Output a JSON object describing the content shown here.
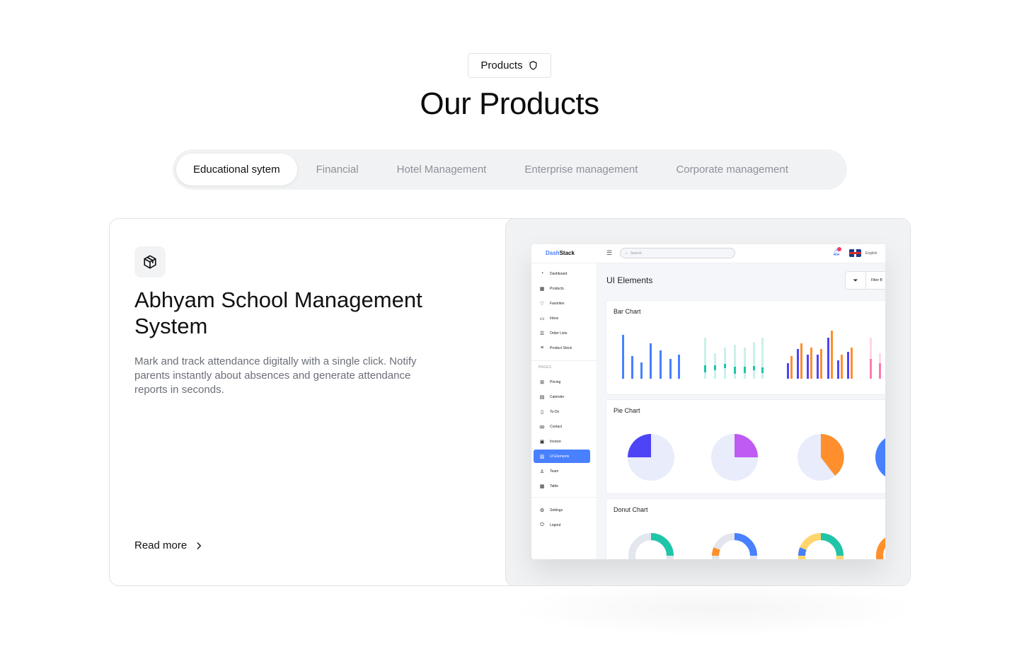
{
  "badge": {
    "label": "Products",
    "icon": "shield-icon"
  },
  "title": "Our Products",
  "tabs": [
    {
      "label": "Educational sytem",
      "active": true
    },
    {
      "label": "Financial",
      "active": false
    },
    {
      "label": "Hotel Management",
      "active": false
    },
    {
      "label": "Enterprise management",
      "active": false
    },
    {
      "label": "Corporate management",
      "active": false
    }
  ],
  "product": {
    "icon": "cube-icon",
    "title": "Abhyam School Management System",
    "description": "Mark and track attendance digitally with a single click. Notify parents instantly about absences and generate attendance reports in seconds.",
    "read_more": "Read more"
  },
  "dashboard": {
    "logo_a": "Dash",
    "logo_b": "Stack",
    "search_placeholder": "Search",
    "language": "English",
    "page_title": "UI Elements",
    "filter_label": "Filter B",
    "sidebar_top": [
      {
        "label": "Dashboard",
        "icon": "dashboard-icon"
      },
      {
        "label": "Products",
        "icon": "grid-icon"
      },
      {
        "label": "Favorites",
        "icon": "heart-icon"
      },
      {
        "label": "Inbox",
        "icon": "inbox-icon"
      },
      {
        "label": "Order Lists",
        "icon": "list-icon"
      },
      {
        "label": "Product Stock",
        "icon": "stock-icon"
      }
    ],
    "pages_label": "PAGES",
    "sidebar_pages": [
      {
        "label": "Pricing",
        "icon": "gift-icon"
      },
      {
        "label": "Calender",
        "icon": "calendar-icon"
      },
      {
        "label": "To-Do",
        "icon": "todo-icon"
      },
      {
        "label": "Contact",
        "icon": "contact-icon"
      },
      {
        "label": "Invoice",
        "icon": "invoice-icon"
      },
      {
        "label": "UI Elements",
        "icon": "chart-icon",
        "active": true
      },
      {
        "label": "Team",
        "icon": "user-icon"
      },
      {
        "label": "Table",
        "icon": "table-icon"
      }
    ],
    "sidebar_bottom": [
      {
        "label": "Settings",
        "icon": "settings-icon"
      },
      {
        "label": "Logout",
        "icon": "power-icon"
      }
    ],
    "panels": {
      "bar": "Bar Chart",
      "pie": "Pie Chart",
      "donut": "Donut Chart"
    },
    "colors": {
      "blue": "#4880ff",
      "indigo": "#4d44f5",
      "teal": "#1fc5a8",
      "orange": "#ff8f2c",
      "purple": "#bf5af2",
      "pink": "#ff7ab0",
      "pale": "#e8ecfb"
    }
  }
}
